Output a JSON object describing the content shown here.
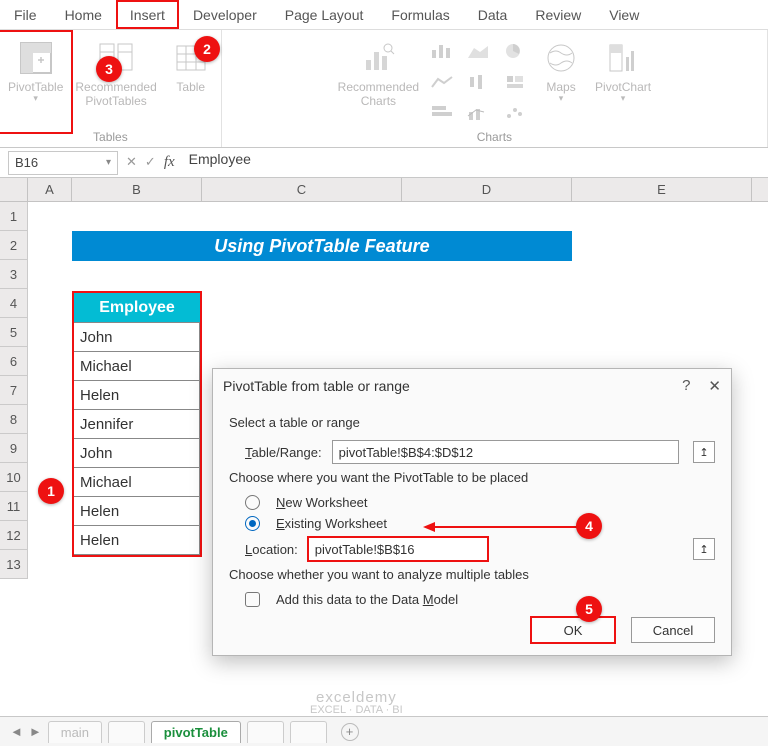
{
  "ribbon": {
    "tabs": [
      "File",
      "Home",
      "Insert",
      "Developer",
      "Page Layout",
      "Formulas",
      "Data",
      "Review",
      "View"
    ],
    "active_tab": "Insert",
    "groups": {
      "tables": {
        "label": "Tables",
        "pivot": "PivotTable",
        "recommended": "Recommended\nPivotTables",
        "table": "Table"
      },
      "charts": {
        "label": "Charts",
        "recommended_charts": "Recommended\nCharts",
        "maps": "Maps",
        "pivotchart": "PivotChart"
      }
    }
  },
  "namebox": {
    "ref": "B16"
  },
  "formula": {
    "value": "Employee"
  },
  "columns": [
    "A",
    "B",
    "C",
    "D",
    "E"
  ],
  "row_numbers": [
    "1",
    "2",
    "3",
    "4",
    "5",
    "6",
    "7",
    "8",
    "9",
    "10",
    "11",
    "12",
    "13"
  ],
  "banner": {
    "title": "Using PivotTable Feature"
  },
  "table": {
    "header": "Employee",
    "rows": [
      "John",
      "Michael",
      "Helen",
      "Jennifer",
      "John",
      "Michael",
      "Helen",
      "Helen"
    ]
  },
  "dialog": {
    "title": "PivotTable from table or range",
    "help": "?",
    "close": "✕",
    "section_select": "Select a table or range",
    "label_table_range": "Table/Range:",
    "table_range_value": "pivotTable!$B$4:$D$12",
    "section_choose": "Choose where you want the PivotTable to be placed",
    "radio_new": "New Worksheet",
    "radio_existing": "Existing Worksheet",
    "label_location": "Location:",
    "location_value": "pivotTable!$B$16",
    "section_multi": "Choose whether you want to analyze multiple tables",
    "check_model": "Add this data to the Data Model",
    "ok": "OK",
    "cancel": "Cancel"
  },
  "badges": {
    "b1": "1",
    "b2": "2",
    "b3": "3",
    "b4": "4",
    "b5": "5"
  },
  "sheets": {
    "inactive": [
      "main",
      "",
      "pivotTable",
      "",
      ""
    ],
    "active": "pivotTable"
  },
  "watermark": {
    "brand": "exceldemy",
    "tag": "EXCEL · DATA · BI"
  }
}
